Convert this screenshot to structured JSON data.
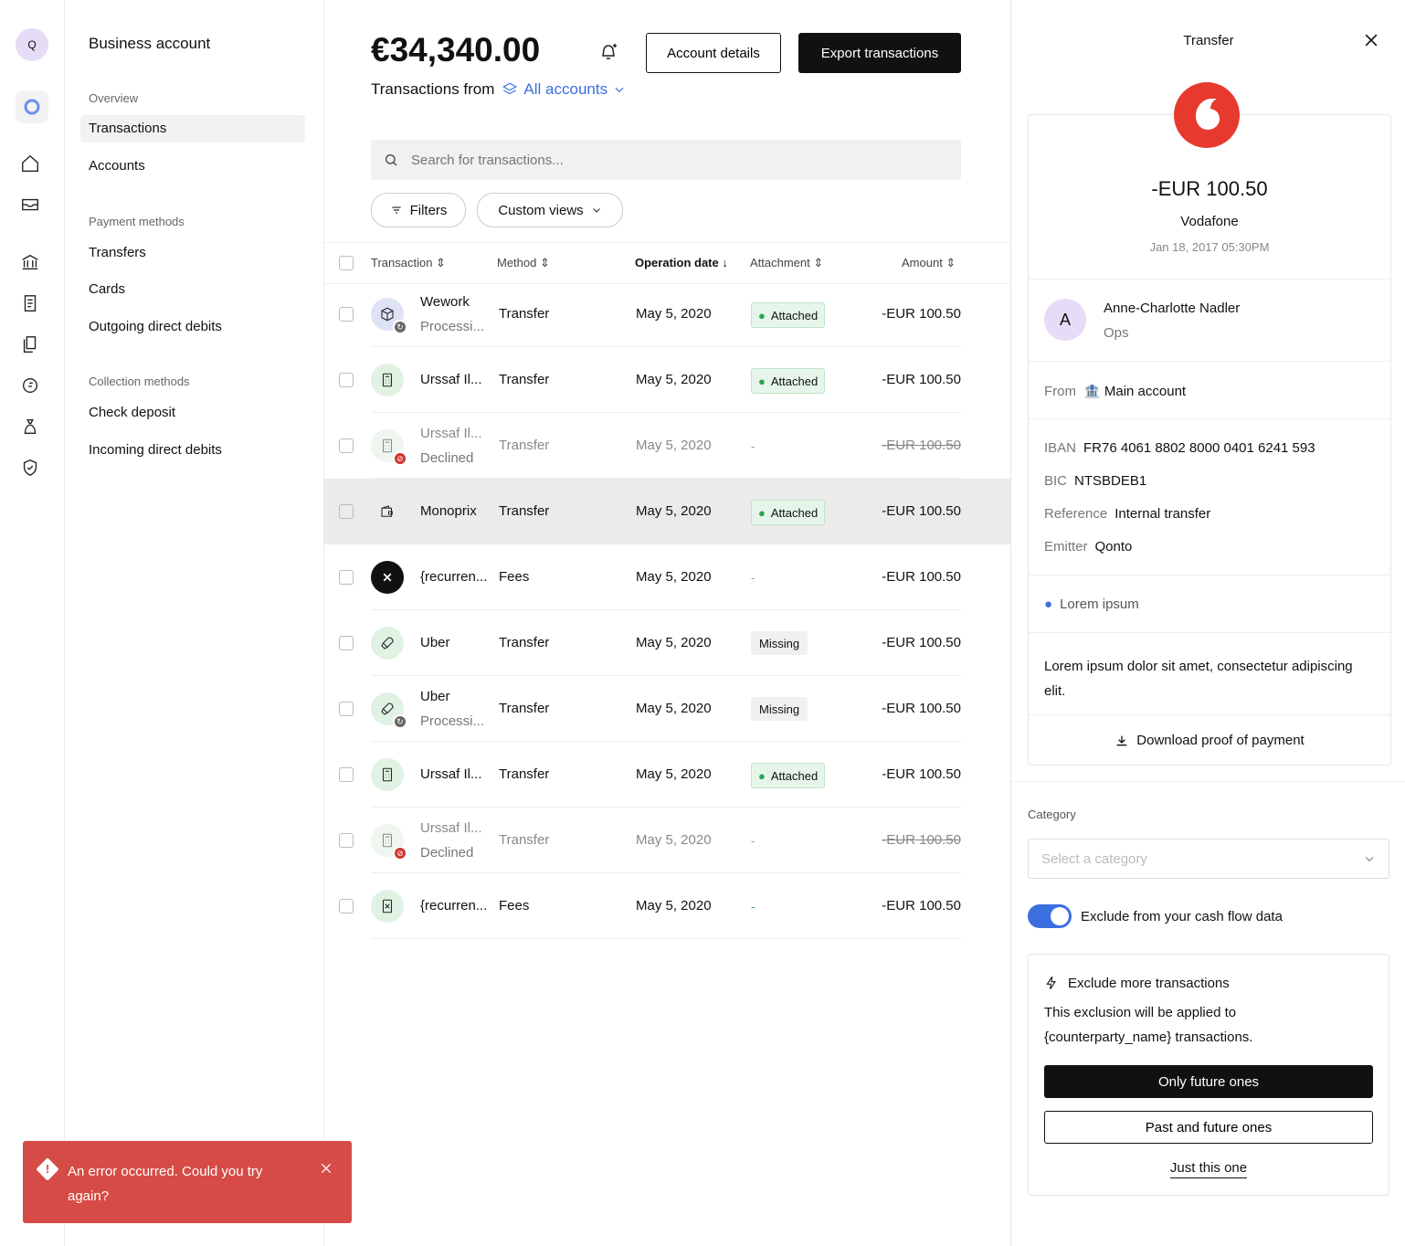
{
  "rail": {
    "avatar": "Q",
    "icons": [
      "home-icon",
      "inbox-icon",
      "bank-icon",
      "invoice-icon",
      "documents-icon",
      "euro-request-icon",
      "money-bag-icon",
      "shield-icon"
    ]
  },
  "sidebar": {
    "title": "Business account",
    "sections": [
      {
        "label": "Overview",
        "items": [
          "Transactions",
          "Accounts"
        ]
      },
      {
        "label": "Payment methods",
        "items": [
          "Transfers",
          "Cards",
          "Outgoing direct debits"
        ]
      },
      {
        "label": "Collection methods",
        "items": [
          "Check deposit",
          "Incoming direct debits"
        ]
      }
    ]
  },
  "header": {
    "balance": "€34,340.00",
    "account_details": "Account details",
    "export": "Export transactions",
    "from_label": "Transactions from",
    "accounts": "All accounts"
  },
  "search": {
    "placeholder": "Search for transactions..."
  },
  "filters": {
    "filters": "Filters",
    "custom_views": "Custom views"
  },
  "table": {
    "columns": {
      "transaction": "Transaction",
      "method": "Method",
      "date": "Operation date",
      "attachment": "Attachment",
      "amount": "Amount"
    },
    "rows": [
      {
        "name": "Wework",
        "sub": "Processi...",
        "method": "Transfer",
        "date": "May 5, 2020",
        "attachment": "Attached",
        "amount": "-EUR 100.50"
      },
      {
        "name": "Urssaf Il...",
        "sub": "",
        "method": "Transfer",
        "date": "May 5, 2020",
        "attachment": "Attached",
        "amount": "-EUR 100.50"
      },
      {
        "name": "Urssaf Il...",
        "sub": "Declined",
        "method": "Transfer",
        "date": "May 5, 2020",
        "attachment": "-",
        "amount": "-EUR 100.50"
      },
      {
        "name": "Monoprix",
        "sub": "",
        "method": "Transfer",
        "date": "May 5, 2020",
        "attachment": "Attached",
        "amount": "-EUR 100.50"
      },
      {
        "name": "{recurren...",
        "sub": "",
        "method": "Fees",
        "date": "May 5, 2020",
        "attachment": "-",
        "amount": "-EUR 100.50"
      },
      {
        "name": "Uber",
        "sub": "",
        "method": "Transfer",
        "date": "May 5, 2020",
        "attachment": "Missing",
        "amount": "-EUR 100.50"
      },
      {
        "name": "Uber",
        "sub": "Processi...",
        "method": "Transfer",
        "date": "May 5, 2020",
        "attachment": "Missing",
        "amount": "-EUR 100.50"
      },
      {
        "name": "Urssaf Il...",
        "sub": "",
        "method": "Transfer",
        "date": "May 5, 2020",
        "attachment": "Attached",
        "amount": "-EUR 100.50"
      },
      {
        "name": "Urssaf Il...",
        "sub": "Declined",
        "method": "Transfer",
        "date": "May 5, 2020",
        "attachment": "-",
        "amount": "-EUR 100.50"
      },
      {
        "name": "{recurren...",
        "sub": "",
        "method": "Fees",
        "date": "May 5, 2020",
        "attachment": "-",
        "amount": "-EUR 100.50"
      }
    ]
  },
  "panel": {
    "title": "Transfer",
    "amount": "-EUR 100.50",
    "counterparty": "Vodafone",
    "datetime": "Jan 18, 2017 05:30PM",
    "user": {
      "initial": "A",
      "name": "Anne-Charlotte Nadler",
      "team": "Ops"
    },
    "from_label": "From",
    "from_value": "Main account",
    "iban_label": "IBAN",
    "iban": "FR76 4061 8802 8000 0401 6241 593",
    "bic_label": "BIC",
    "bic": "NTSBDEB1",
    "reference_label": "Reference",
    "reference": "Internal transfer",
    "emitter_label": "Emitter",
    "emitter": "Qonto",
    "info": "Lorem ipsum",
    "note": "Lorem ipsum dolor sit amet, consectetur adipiscing elit.",
    "download": "Download proof of payment",
    "category_label": "Category",
    "category_placeholder": "Select a category",
    "exclude_toggle": "Exclude from your cash flow data",
    "exclude_title": "Exclude more transactions",
    "exclude_desc": "This exclusion will be applied to {counterparty_name} transactions.",
    "only_future": "Only future ones",
    "past_future": "Past and future ones",
    "just_this": "Just this one"
  },
  "toast": {
    "message": "An error occurred. Could you try again?"
  },
  "colors": {
    "accent": "#3b6fe0",
    "error": "#d64b45",
    "brand_logo": "#e63a2e"
  }
}
